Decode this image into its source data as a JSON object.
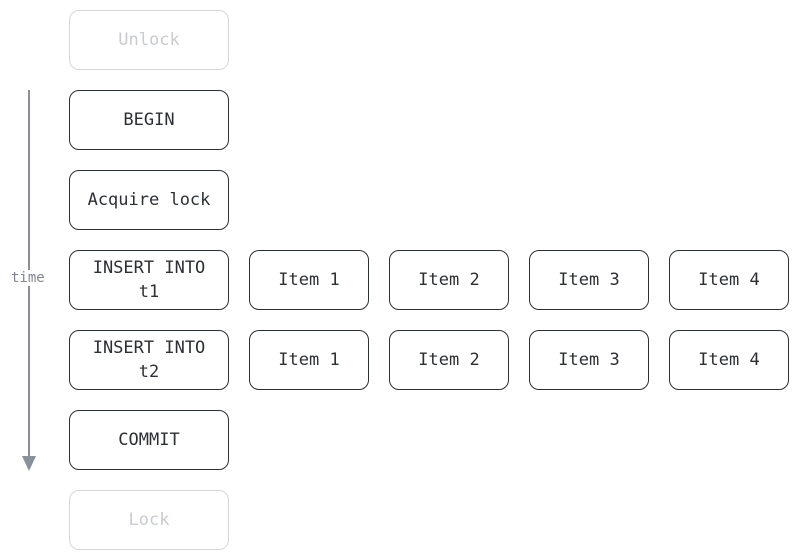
{
  "axis": {
    "label": "time",
    "direction": "down",
    "color": "#8a9099"
  },
  "steps": [
    {
      "label": "Unlock",
      "faded": true
    },
    {
      "label": "BEGIN",
      "faded": false
    },
    {
      "label": "Acquire lock",
      "faded": false
    },
    {
      "label": "INSERT INTO\nt1",
      "faded": false,
      "items": [
        "Item 1",
        "Item 2",
        "Item 3",
        "Item 4"
      ]
    },
    {
      "label": "INSERT INTO\nt2",
      "faded": false,
      "items": [
        "Item 1",
        "Item 2",
        "Item 3",
        "Item 4"
      ]
    },
    {
      "label": "COMMIT",
      "faded": false
    },
    {
      "label": "Lock",
      "faded": true
    }
  ],
  "colors": {
    "stroke": "#2b2f36",
    "faded": "#d4d7dc"
  }
}
